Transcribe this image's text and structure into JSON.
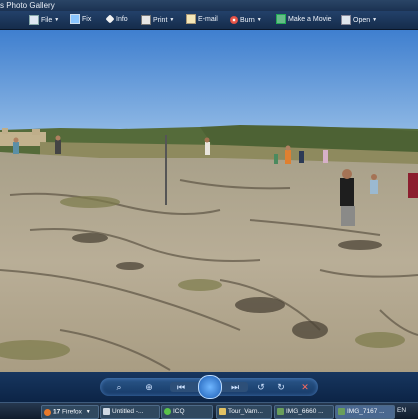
{
  "window": {
    "title": "s Photo Gallery"
  },
  "toolbar": {
    "items": [
      {
        "label": "File",
        "icon": "file-icon",
        "has_menu": true
      },
      {
        "label": "Fix",
        "icon": "fix-icon",
        "has_menu": false
      },
      {
        "label": "Info",
        "icon": "info-icon",
        "has_menu": false
      },
      {
        "label": "Print",
        "icon": "print-icon",
        "has_menu": true
      },
      {
        "label": "E-mail",
        "icon": "email-icon",
        "has_menu": false
      },
      {
        "label": "Burn",
        "icon": "burn-icon",
        "has_menu": true
      },
      {
        "label": "Make a Movie",
        "icon": "movie-icon",
        "has_menu": false
      },
      {
        "label": "Open",
        "icon": "open-icon",
        "has_menu": true
      }
    ],
    "caret": "▼"
  },
  "photo": {
    "description_icon": "photo-landscape"
  },
  "controls": {
    "zoom": "⌕",
    "fit": "⊕",
    "prev": "⏮",
    "next": "⏭",
    "rotate_left": "↺",
    "rotate_right": "↻",
    "delete": "✕"
  },
  "taskbar": {
    "tasks": [
      {
        "count": "17",
        "label": "Firefox",
        "has_menu": true
      },
      {
        "label": "Untitled -..."
      },
      {
        "label": "ICQ"
      },
      {
        "label": "Tour_Varn..."
      },
      {
        "label": "IMG_6660 ..."
      },
      {
        "label": "IMG_7167 ..."
      }
    ],
    "language": "EN"
  },
  "colors": {
    "accent": "#1d5eb5",
    "sky": "#5b94d6",
    "rock": "#b8ad96"
  }
}
